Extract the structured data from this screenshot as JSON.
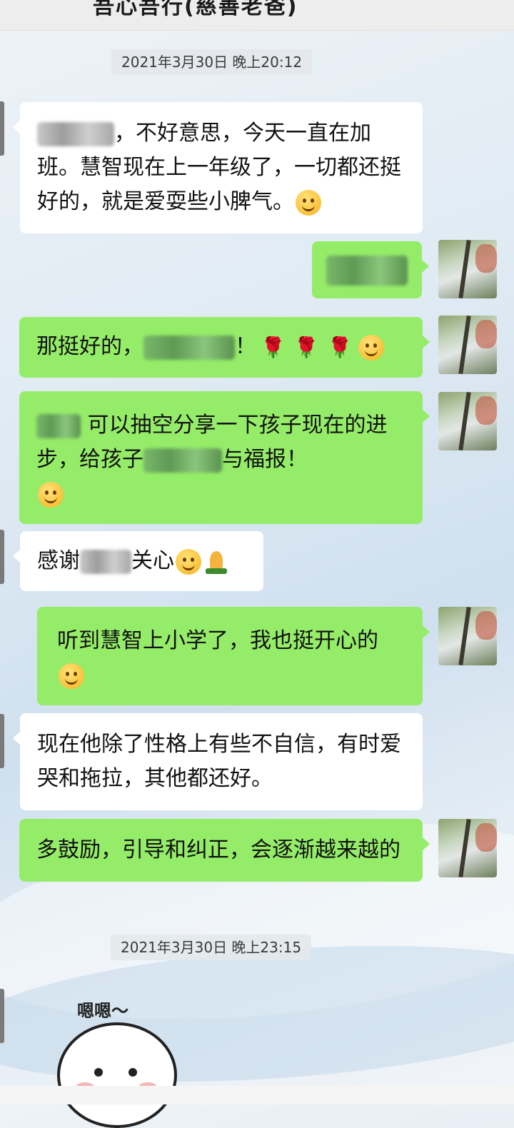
{
  "header": {
    "title": "吾心吾行(慈善老爸)"
  },
  "timestamps": [
    "2021年3月30日 晚上20:12",
    "2021年3月30日 晚上23:15"
  ],
  "messages": {
    "m1": {
      "before": "",
      "after": "，不好意思，今天一直在加班。慧智现在上一年级了，一切都还挺好的，就是爱耍些小脾气。"
    },
    "m2": {
      "text": ""
    },
    "m3": {
      "before": "那挺好的，",
      "after": "！"
    },
    "m4": {
      "before": "",
      "mid": " 可以抽空分享一下孩子现在的进步，给孩子",
      "after": "与福报！"
    },
    "m5": {
      "before": "感谢",
      "after": "关心"
    },
    "m6": {
      "text": "听到慧智上小学了，我也挺开心的"
    },
    "m7": {
      "text": "现在他除了性格上有些不自信，有时爱哭和拖拉，其他都还好。"
    },
    "m8": {
      "text": "多鼓励，引导和纠正，会逐渐越来越的"
    }
  },
  "sticker": {
    "caption": "嗯嗯～"
  },
  "icons": {
    "smile": "smile-emoji-icon",
    "rose": "rose-emoji-icon",
    "pray": "pray-emoji-icon"
  },
  "colors": {
    "bubble_self": "#95ec69",
    "bubble_other": "#ffffff",
    "rose": "#d8242b"
  }
}
